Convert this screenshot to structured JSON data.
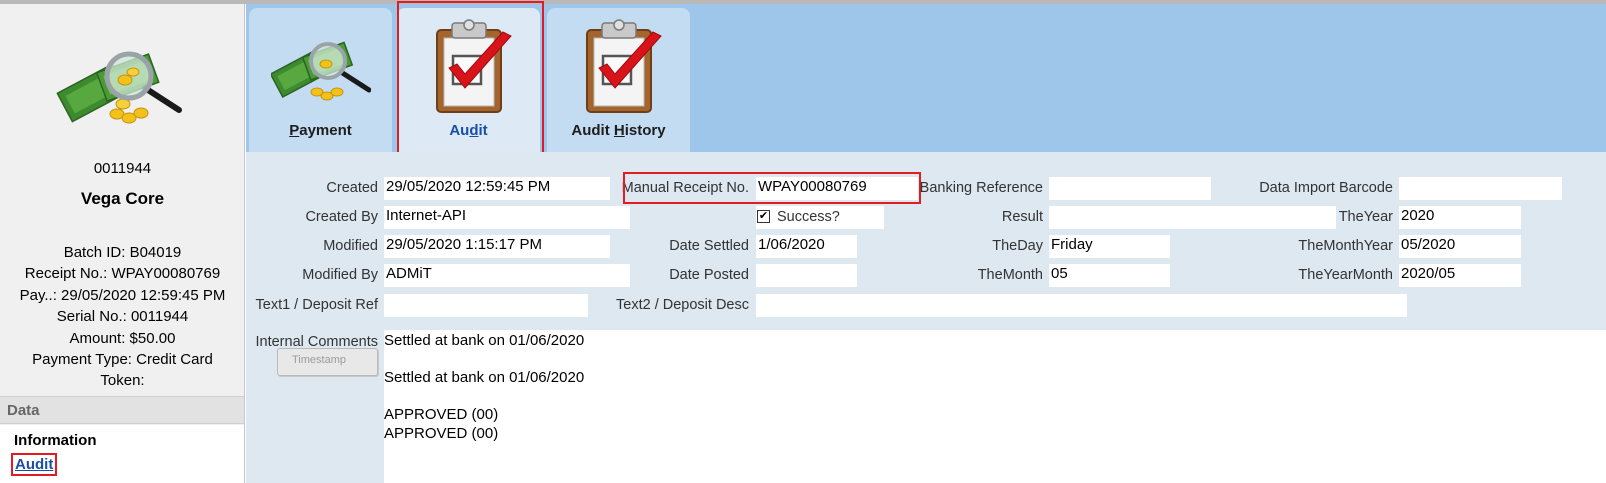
{
  "sidebar": {
    "record_id": "0011944",
    "name": "Vega Core",
    "details": [
      "Batch ID: B04019",
      "Receipt No.: WPAY00080769",
      "Pay..: 29/05/2020 12:59:45 PM",
      "Serial No.: 0011944",
      "Amount: $50.00",
      "Payment Type: Credit Card",
      "Token:"
    ],
    "data_header": "Data",
    "data_items": [
      "Information",
      "Audit"
    ]
  },
  "tabs": [
    {
      "label": "Payment",
      "icon": "money-search-icon",
      "active": false
    },
    {
      "label": "Audit",
      "icon": "clipboard-check-icon",
      "active": true
    },
    {
      "label": "Audit History",
      "icon": "clipboard-check-icon",
      "active": false
    }
  ],
  "form": {
    "created_label": "Created",
    "created": "29/05/2020 12:59:45 PM",
    "created_by_label": "Created By",
    "created_by": "Internet-API",
    "modified_label": "Modified",
    "modified": "29/05/2020 1:15:17 PM",
    "modified_by_label": "Modified By",
    "modified_by": "ADMiT",
    "text1_label": "Text1 / Deposit Ref",
    "text1": "",
    "manual_receipt_label": "Manual Receipt No.",
    "manual_receipt": "WPAY00080769",
    "success_label": "Success?",
    "success_checked": true,
    "date_settled_label": "Date Settled",
    "date_settled": "1/06/2020",
    "date_posted_label": "Date Posted",
    "date_posted": "",
    "text2_label": "Text2 / Deposit Desc",
    "text2": "",
    "banking_ref_label": "Banking Reference",
    "banking_ref": "",
    "result_label": "Result",
    "result": "",
    "theday_label": "TheDay",
    "theday": "Friday",
    "themonth_label": "TheMonth",
    "themonth": "05",
    "import_barcode_label": "Data Import Barcode",
    "import_barcode": "",
    "theyear_label": "TheYear",
    "theyear": "2020",
    "themonthyear_label": "TheMonthYear",
    "themonthyear": "05/2020",
    "theyearmonth_label": "TheYearMonth",
    "theyearmonth": "2020/05",
    "internal_comments_label": "Internal Comments",
    "timestamp_button": "Timestamp",
    "comments": [
      "Settled at bank on 01/06/2020",
      "",
      "Settled at bank on 01/06/2020",
      "",
      "APPROVED (00)",
      "APPROVED (00)"
    ]
  },
  "colors": {
    "tab_strip": "#9dc6ea",
    "content_bg": "#dde8f1",
    "highlight_red": "#e31c23",
    "link_blue": "#1a4fa8"
  }
}
